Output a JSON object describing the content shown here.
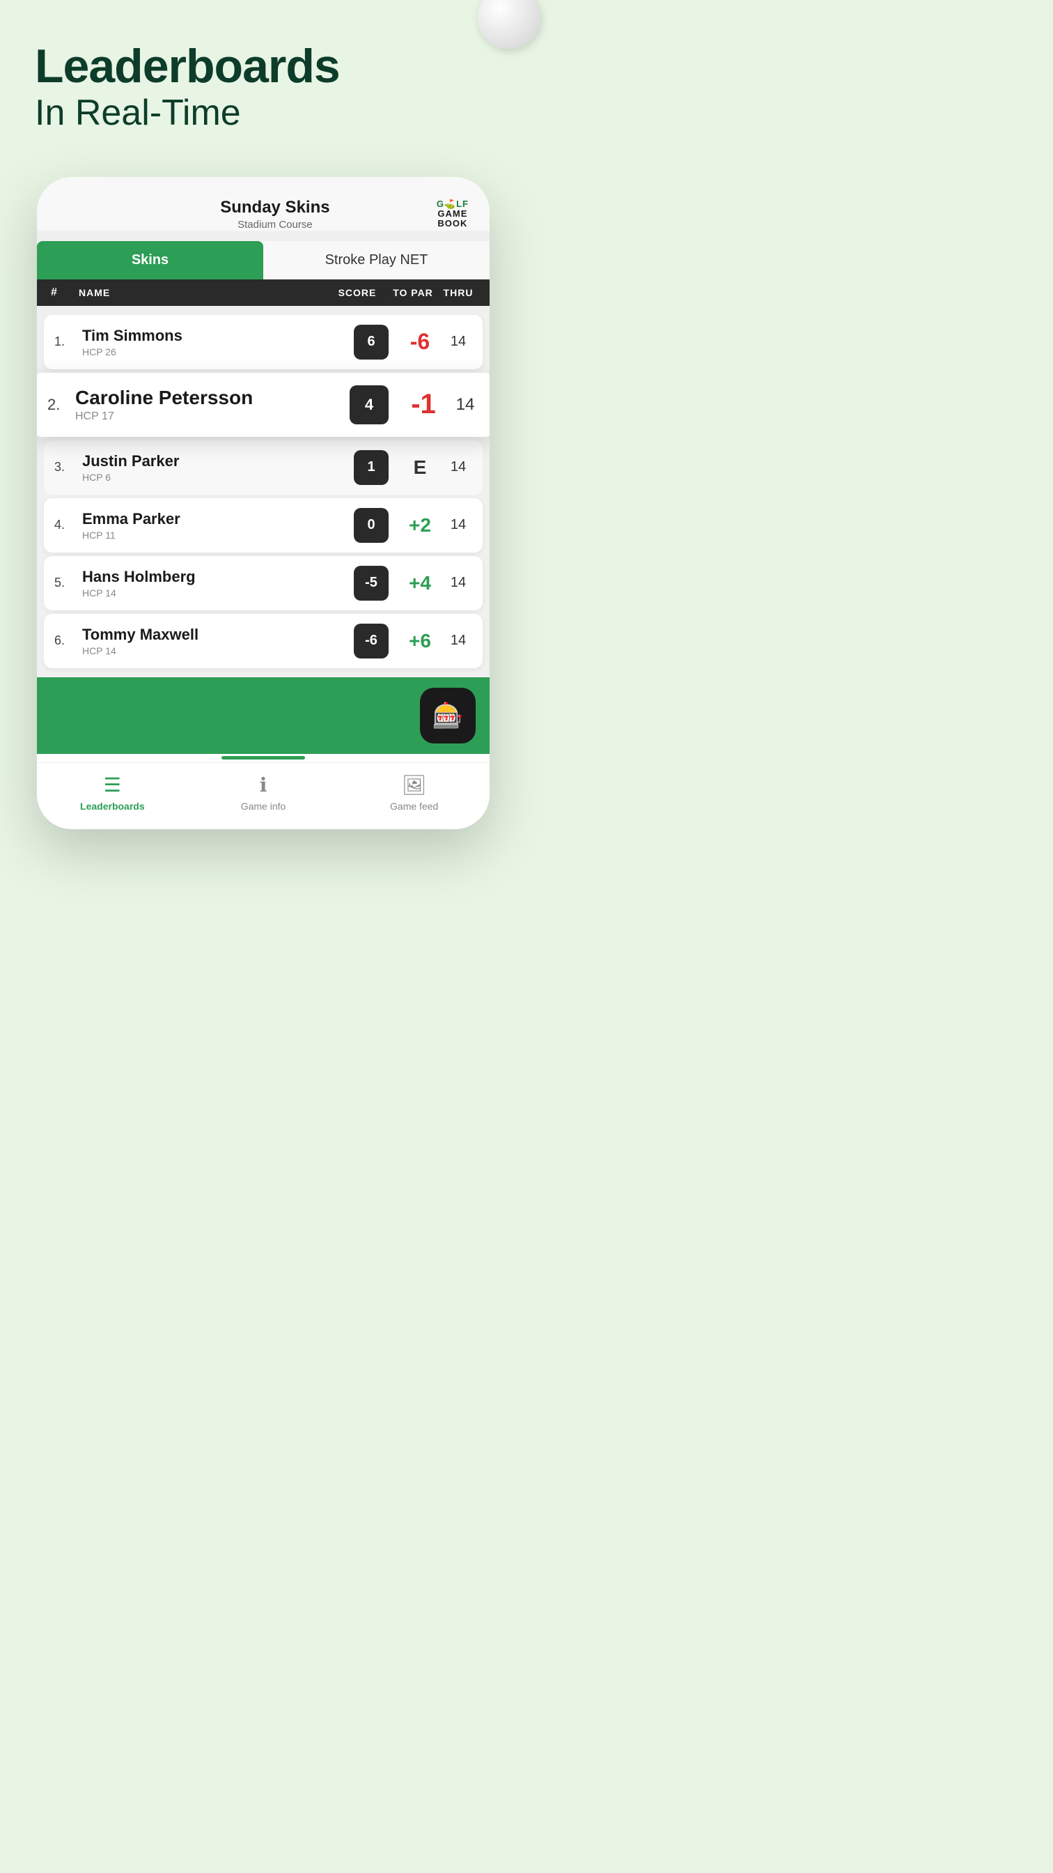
{
  "page": {
    "headline": "Leaderboards",
    "subheadline": "In Real-Time"
  },
  "logo": {
    "golf": "G⛳LF",
    "game": "GAME",
    "book": "BOOK"
  },
  "app": {
    "title": "Sunday Skins",
    "subtitle": "Stadium Course",
    "tab_active": "Skins",
    "tab_inactive": "Stroke Play NET"
  },
  "table": {
    "col_hash": "#",
    "col_name": "NAME",
    "col_score": "SCORE",
    "col_topar": "TO PAR",
    "col_thru": "THRU"
  },
  "players": [
    {
      "rank": "1.",
      "name": "Tim Simmons",
      "hcp": "HCP 26",
      "score": "6",
      "topar": "-6",
      "topar_type": "red",
      "thru": "14",
      "highlighted": false,
      "plain": false
    },
    {
      "rank": "2.",
      "name": "Caroline Petersson",
      "hcp": "HCP 17",
      "score": "4",
      "topar": "-1",
      "topar_type": "red",
      "thru": "14",
      "highlighted": true,
      "plain": false
    },
    {
      "rank": "3.",
      "name": "Justin Parker",
      "hcp": "HCP 6",
      "score": "1",
      "topar": "E",
      "topar_type": "even",
      "thru": "14",
      "highlighted": false,
      "plain": true
    },
    {
      "rank": "4.",
      "name": "Emma Parker",
      "hcp": "HCP 11",
      "score": "0",
      "topar": "+2",
      "topar_type": "green",
      "thru": "14",
      "highlighted": false,
      "plain": false
    },
    {
      "rank": "5.",
      "name": "Hans Holmberg",
      "hcp": "HCP 14",
      "score": "-5",
      "topar": "+4",
      "topar_type": "green",
      "thru": "14",
      "highlighted": false,
      "plain": false
    },
    {
      "rank": "6.",
      "name": "Tommy Maxwell",
      "hcp": "HCP 14",
      "score": "-6",
      "topar": "+6",
      "topar_type": "green",
      "thru": "14",
      "highlighted": false,
      "plain": false
    }
  ],
  "bottom_nav": {
    "leaderboards_label": "Leaderboards",
    "game_info_label": "Game info",
    "game_feed_label": "Game feed"
  }
}
